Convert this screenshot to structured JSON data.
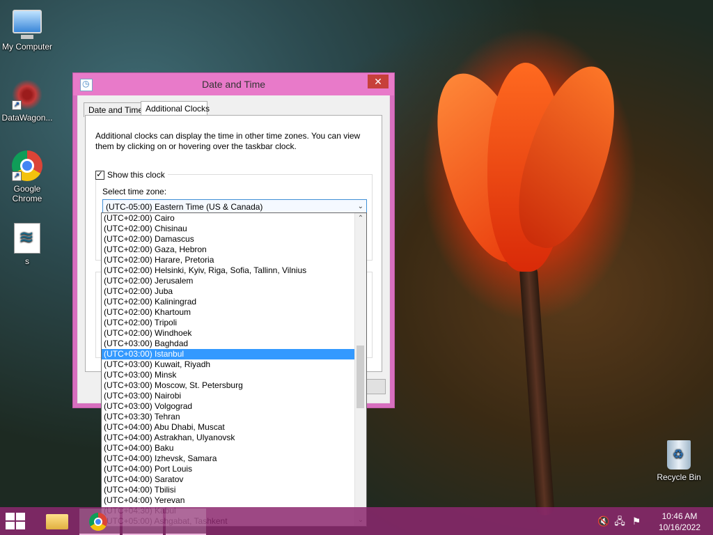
{
  "desktop": {
    "icons": [
      {
        "label": "My Computer"
      },
      {
        "label": "DataWagon..."
      },
      {
        "label": "Google Chrome"
      },
      {
        "label": "s"
      },
      {
        "label": "Recycle Bin"
      }
    ]
  },
  "dialog": {
    "title": "Date and Time",
    "close_glyph": "✕",
    "tabs": [
      {
        "label": "Date and Time"
      },
      {
        "label": "Additional Clocks"
      }
    ],
    "description": "Additional clocks can display the time in other time zones. You can view them by clicking on or hovering over the taskbar clock.",
    "show_clock_label": "Show this clock",
    "select_label": "Select time zone:",
    "selected_zone": "(UTC-05:00) Eastern Time (US & Canada)"
  },
  "dropdown": {
    "options": [
      "(UTC+02:00) Cairo",
      "(UTC+02:00) Chisinau",
      "(UTC+02:00) Damascus",
      "(UTC+02:00) Gaza, Hebron",
      "(UTC+02:00) Harare, Pretoria",
      "(UTC+02:00) Helsinki, Kyiv, Riga, Sofia, Tallinn, Vilnius",
      "(UTC+02:00) Jerusalem",
      "(UTC+02:00) Juba",
      "(UTC+02:00) Kaliningrad",
      "(UTC+02:00) Khartoum",
      "(UTC+02:00) Tripoli",
      "(UTC+02:00) Windhoek",
      "(UTC+03:00) Baghdad",
      "(UTC+03:00) Istanbul",
      "(UTC+03:00) Kuwait, Riyadh",
      "(UTC+03:00) Minsk",
      "(UTC+03:00) Moscow, St. Petersburg",
      "(UTC+03:00) Nairobi",
      "(UTC+03:00) Volgograd",
      "(UTC+03:30) Tehran",
      "(UTC+04:00) Abu Dhabi, Muscat",
      "(UTC+04:00) Astrakhan, Ulyanovsk",
      "(UTC+04:00) Baku",
      "(UTC+04:00) Izhevsk, Samara",
      "(UTC+04:00) Port Louis",
      "(UTC+04:00) Saratov",
      "(UTC+04:00) Tbilisi",
      "(UTC+04:00) Yerevan",
      "(UTC+04:30) Kabul",
      "(UTC+05:00) Ashgabat, Tashkent"
    ],
    "highlighted": "(UTC+03:00) Istanbul"
  },
  "taskbar": {
    "time": "10:46 AM",
    "date": "10/16/2022"
  },
  "colors": {
    "title_bar": "#e87ac9",
    "selection": "#3399ff",
    "taskbar": "#8c286e"
  }
}
